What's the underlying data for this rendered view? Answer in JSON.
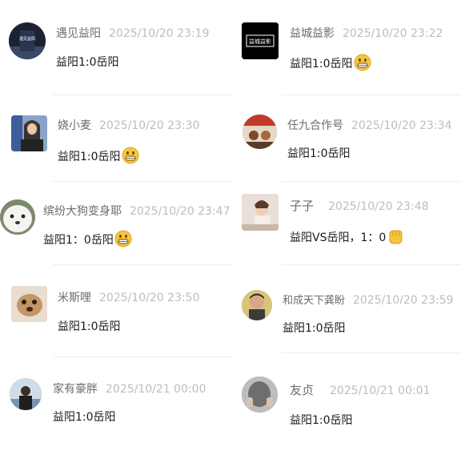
{
  "comments": [
    {
      "username": "遇见益阳",
      "time": "2025/10/20 23:19",
      "text": "益阳1:0岳阳",
      "emoji": ""
    },
    {
      "username": "益城益影",
      "time": "2025/10/20 23:22",
      "text": "益阳1:0岳阳",
      "emoji": "grin-emoji"
    },
    {
      "username": "娆小麦",
      "time": "2025/10/20 23:30",
      "text": "益阳1:0岳阳",
      "emoji": "grin-emoji"
    },
    {
      "username": "任九合作号",
      "time": "2025/10/20 23:34",
      "text": "益阳1:0岳阳",
      "emoji": ""
    },
    {
      "username": "缤纷大狗变身耶",
      "time": "2025/10/20 23:47",
      "text": "益阳1：0岳阳",
      "emoji": "grin-emoji"
    },
    {
      "username": "子子",
      "time": "2025/10/20 23:48",
      "text": "益阳VS岳阳，1：0",
      "emoji": "fist-emoji"
    },
    {
      "username": "米斯哩",
      "time": "2025/10/20 23:50",
      "text": "益阳1:0岳阳",
      "emoji": ""
    },
    {
      "username": "和成天下龚盼",
      "time": "2025/10/20 23:59",
      "text": "益阳1:0岳阳",
      "emoji": ""
    },
    {
      "username": "家有豪胖",
      "time": "2025/10/21 00:00",
      "text": "益阳1:0岳阳",
      "emoji": ""
    },
    {
      "username": "友贞",
      "time": "2025/10/21 00:01",
      "text": "益阳1:0岳阳",
      "emoji": ""
    }
  ],
  "avatars": {
    "logo_text": "益城益影",
    "top_left_badge": "遇见益阳"
  }
}
